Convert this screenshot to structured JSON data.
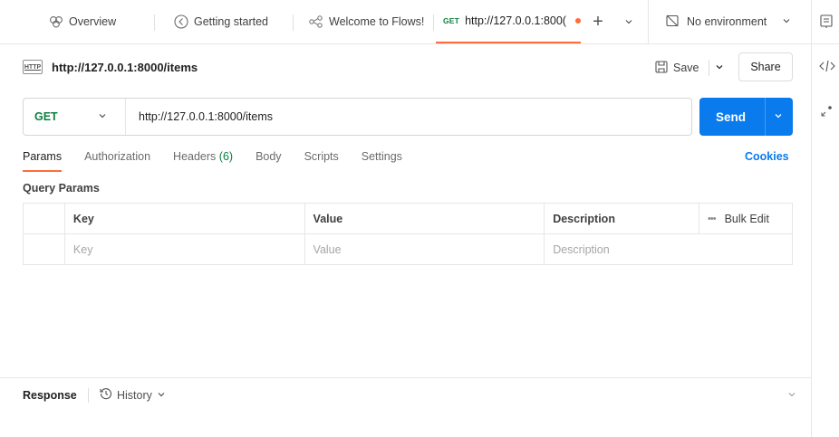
{
  "tabs": [
    {
      "label": "Overview",
      "icon": "overview-icon"
    },
    {
      "label": "Getting started",
      "icon": "getting-started-icon"
    },
    {
      "label": "Welcome to Flows!",
      "icon": "flows-icon"
    },
    {
      "method": "GET",
      "label": "http://127.0.0.1:800(",
      "icon": "unsaved-dot-icon"
    }
  ],
  "environment": {
    "label": "No environment"
  },
  "request": {
    "title": "http://127.0.0.1:8000/items",
    "badge": "HTTP",
    "save_label": "Save",
    "share_label": "Share",
    "method": "GET",
    "url": "http://127.0.0.1:8000/items",
    "send_label": "Send"
  },
  "subtabs": {
    "params": "Params",
    "authorization": "Authorization",
    "headers": "Headers",
    "headers_count": "(6)",
    "body": "Body",
    "scripts": "Scripts",
    "settings": "Settings",
    "cookies": "Cookies"
  },
  "query_params": {
    "title": "Query Params",
    "columns": [
      "Key",
      "Value",
      "Description"
    ],
    "bulk_edit": "Bulk Edit",
    "placeholders": [
      "Key",
      "Value",
      "Description"
    ]
  },
  "response": {
    "title": "Response",
    "history_label": "History"
  },
  "colors": {
    "accent": "#ff6c37",
    "send": "#097bed",
    "get_method": "#0c8040"
  }
}
